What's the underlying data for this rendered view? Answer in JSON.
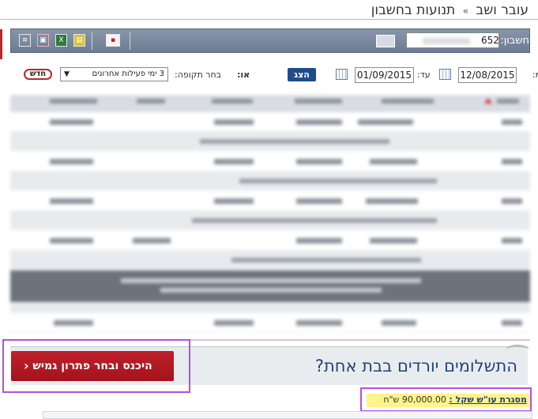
{
  "breadcrumb": {
    "parent": "עובר ושב",
    "separator": "»",
    "current": "תנועות בחשבון"
  },
  "toolbar": {
    "account_label": "חשבון:",
    "account_value": "652",
    "icons": [
      "print-icon",
      "save-icon",
      "excel-icon",
      "print-preview-icon",
      "contact-card-icon",
      "mail-icon"
    ]
  },
  "filter": {
    "from_label": "מ:",
    "from_date": "12/08/2015",
    "to_label": "עד:",
    "to_date": "01/09/2015",
    "show_button": "הצג",
    "or_label": "או:",
    "period_label": "בחר תקופה:",
    "period_value": "3 ימי פעילות אחרונים",
    "new_button": "חדש"
  },
  "promo": {
    "headline": "התשלומים יורדים בבת אחת?",
    "button_label": "היכנס ובחר פתרון גמיש"
  },
  "credit": {
    "label": "מסגרת עו\"ש שקל :",
    "value": "90,000.00",
    "currency": "ש\"ח"
  },
  "colors": {
    "toolbar": "#7a889e",
    "accent_red": "#b8232b",
    "link_blue": "#1f4478",
    "highlight": "#fff48a",
    "annotation_purple": "#b44fe0"
  }
}
